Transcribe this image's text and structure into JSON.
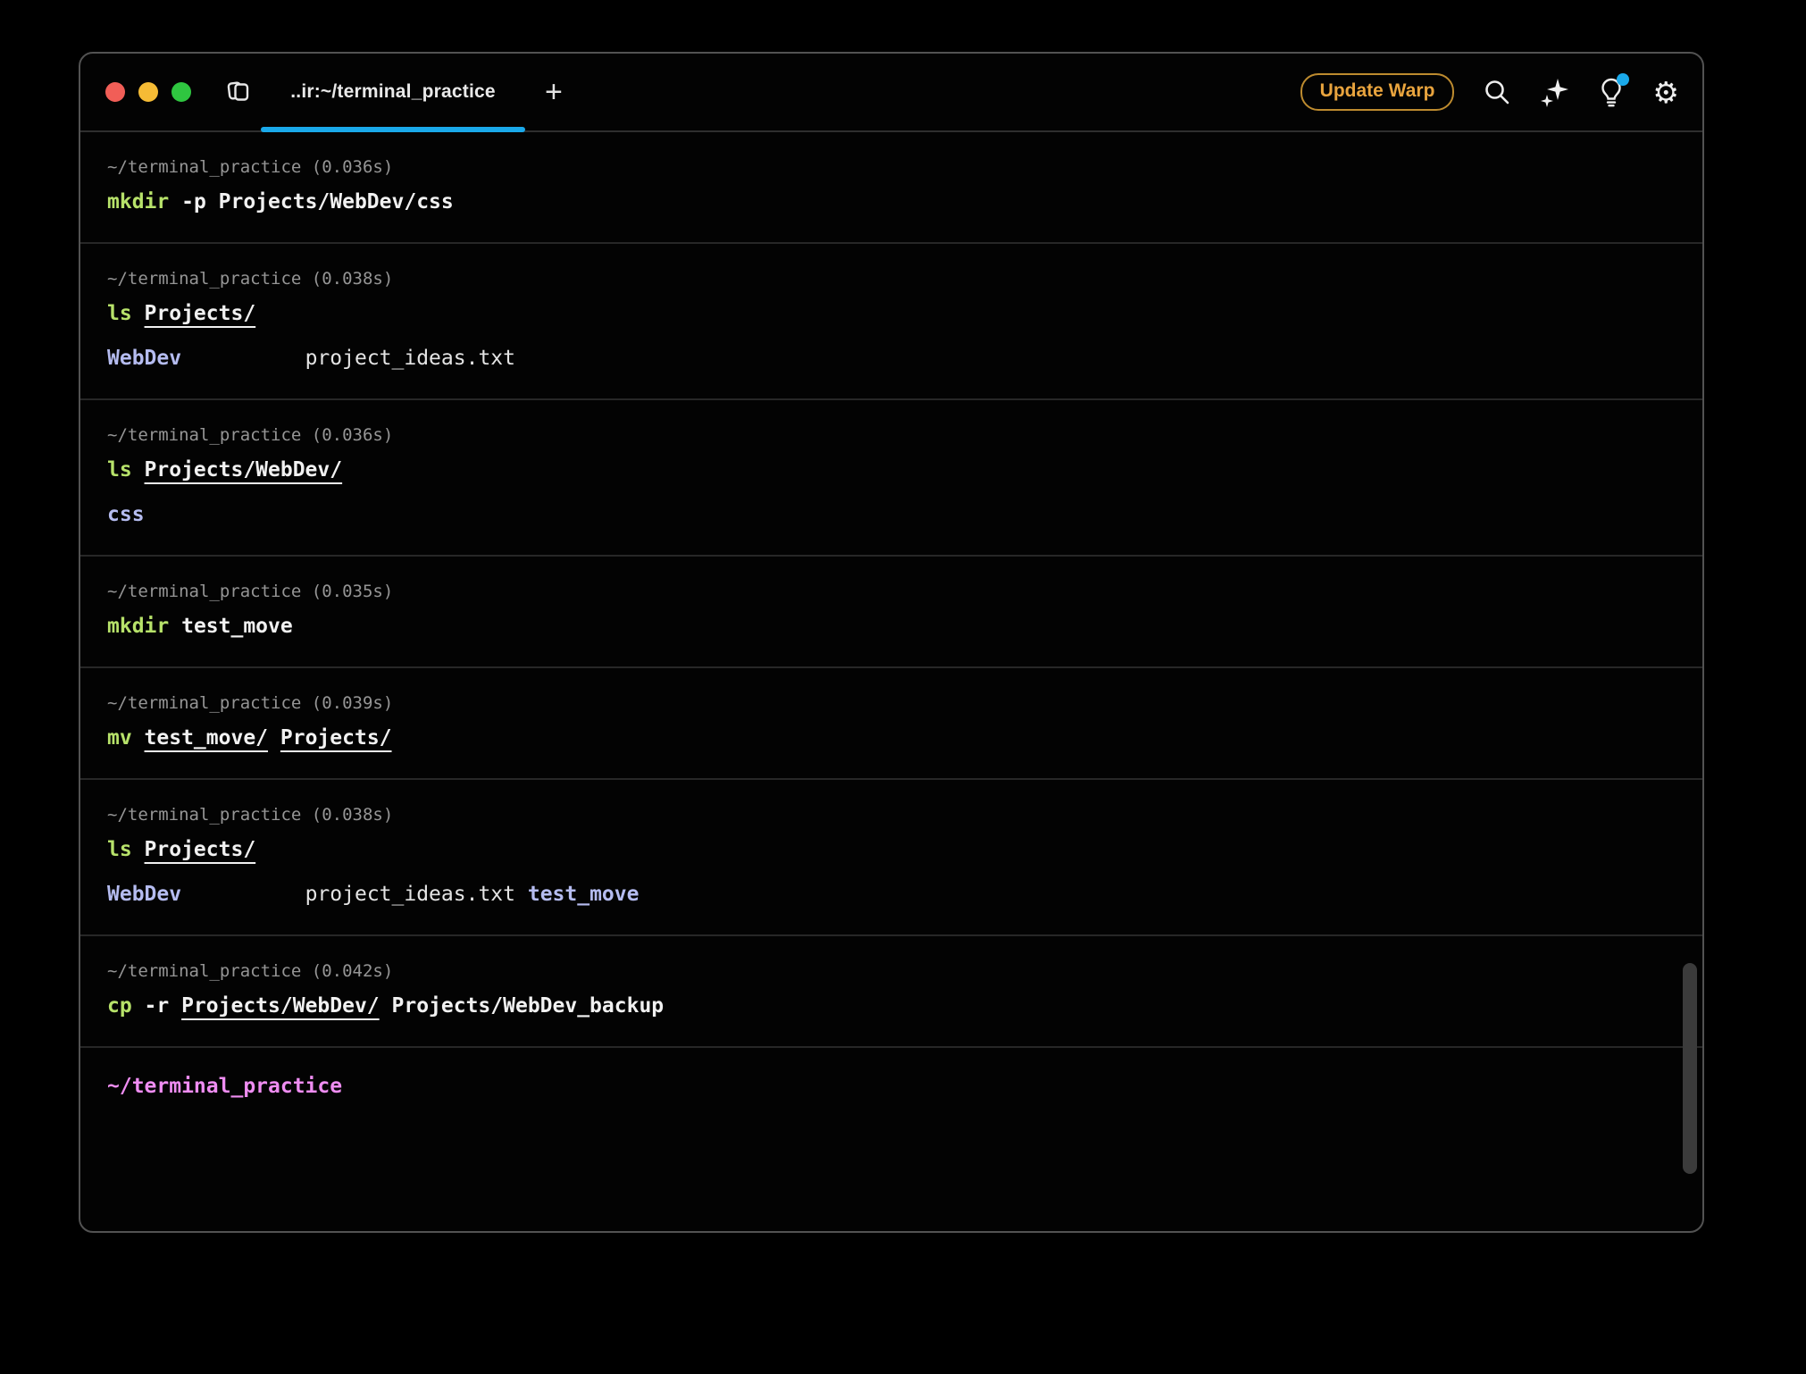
{
  "colors": {
    "accent_blue": "#1aa9ea",
    "cmd_green": "#b7e26a",
    "dir_lavender": "#b5bcf0",
    "prompt_pink": "#ef8df2",
    "context_gray": "#959595",
    "text_white": "#f1f1f1",
    "gold_text": "#e9a43e",
    "gold_border": "#bd8b2f",
    "traffic_red": "#f15e57",
    "traffic_yellow": "#f5bb35",
    "traffic_green": "#2fc640"
  },
  "header": {
    "tab_title": "..ir:~/terminal_practice",
    "new_tab_label": "+",
    "update_label": "Update Warp",
    "icons": [
      {
        "name": "bookmarks-icon"
      },
      {
        "name": "search-icon"
      },
      {
        "name": "sparkles-icon"
      },
      {
        "name": "lightbulb-icon",
        "notification": true
      },
      {
        "name": "gear-icon",
        "glyph": "⚙"
      }
    ]
  },
  "terminal": {
    "blocks": [
      {
        "context": "~/terminal_practice (0.036s)",
        "command": [
          {
            "t": "mkdir",
            "s": "cmd"
          },
          {
            "t": " -p Projects/WebDev/css",
            "s": "arg"
          }
        ],
        "output": []
      },
      {
        "context": "~/terminal_practice (0.038s)",
        "command": [
          {
            "t": "ls ",
            "s": "cmd"
          },
          {
            "t": "Projects/",
            "s": "argu"
          }
        ],
        "output": [
          [
            {
              "t": "WebDev",
              "s": "dir"
            },
            {
              "t": "          ",
              "s": "plain"
            },
            {
              "t": "project_ideas.txt",
              "s": "file"
            }
          ]
        ]
      },
      {
        "context": "~/terminal_practice (0.036s)",
        "command": [
          {
            "t": "ls ",
            "s": "cmd"
          },
          {
            "t": "Projects/WebDev/",
            "s": "argu"
          }
        ],
        "output": [
          [
            {
              "t": "css",
              "s": "dir"
            }
          ]
        ]
      },
      {
        "context": "~/terminal_practice (0.035s)",
        "command": [
          {
            "t": "mkdir",
            "s": "cmd"
          },
          {
            "t": " test_move",
            "s": "arg"
          }
        ],
        "output": []
      },
      {
        "context": "~/terminal_practice (0.039s)",
        "command": [
          {
            "t": "mv ",
            "s": "cmd"
          },
          {
            "t": "test_move/",
            "s": "argu"
          },
          {
            "t": " ",
            "s": "arg"
          },
          {
            "t": "Projects/",
            "s": "argu"
          }
        ],
        "output": []
      },
      {
        "context": "~/terminal_practice (0.038s)",
        "command": [
          {
            "t": "ls ",
            "s": "cmd"
          },
          {
            "t": "Projects/",
            "s": "argu"
          }
        ],
        "output": [
          [
            {
              "t": "WebDev",
              "s": "dir"
            },
            {
              "t": "          ",
              "s": "plain"
            },
            {
              "t": "project_ideas.txt",
              "s": "file"
            },
            {
              "t": " ",
              "s": "plain"
            },
            {
              "t": "test_move",
              "s": "dir"
            }
          ]
        ]
      },
      {
        "context": "~/terminal_practice (0.042s)",
        "command": [
          {
            "t": "cp",
            "s": "cmd"
          },
          {
            "t": " -r ",
            "s": "arg"
          },
          {
            "t": "Projects/WebDev/",
            "s": "argu"
          },
          {
            "t": " Projects/WebDev_backup",
            "s": "arg"
          }
        ],
        "output": []
      }
    ],
    "prompt": "~/terminal_practice"
  }
}
